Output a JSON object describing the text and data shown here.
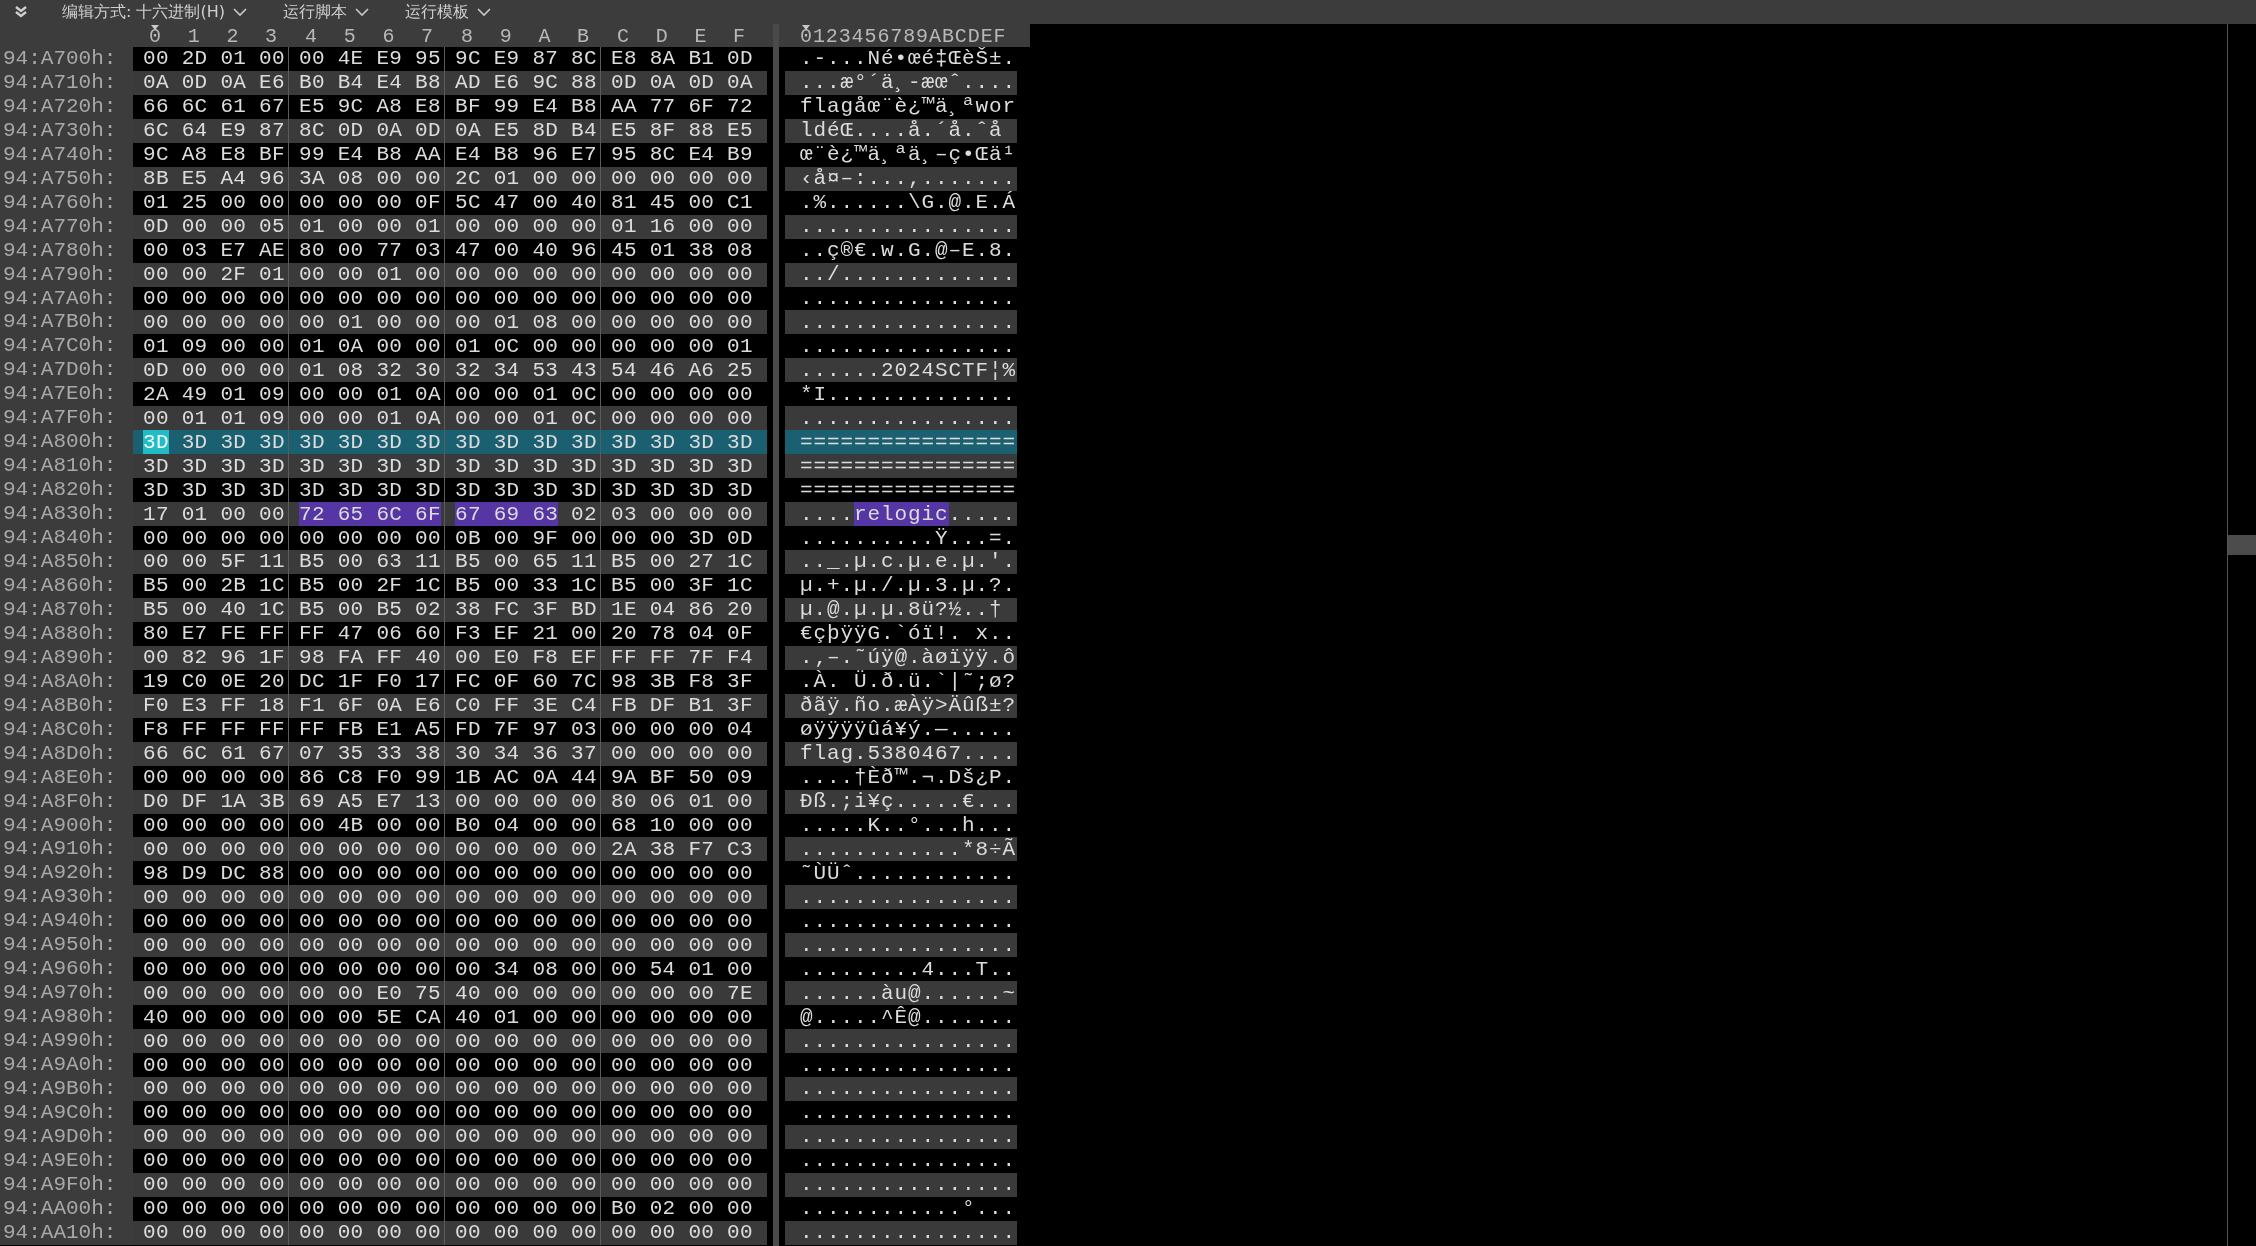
{
  "toolbar": {
    "menus": [
      "编辑方式: 十六进制(H)",
      "运行脚本",
      "运行模板"
    ]
  },
  "header": {
    "hex_columns": [
      {
        "label": "0",
        "cursor": true
      },
      {
        "label": "1",
        "cursor": false
      },
      {
        "label": "2",
        "cursor": false
      },
      {
        "label": "3",
        "cursor": false
      },
      {
        "label": "4",
        "cursor": false
      },
      {
        "label": "5",
        "cursor": false
      },
      {
        "label": "6",
        "cursor": false
      },
      {
        "label": "7",
        "cursor": false
      },
      {
        "label": "8",
        "cursor": false
      },
      {
        "label": "9",
        "cursor": false
      },
      {
        "label": "A",
        "cursor": false
      },
      {
        "label": "B",
        "cursor": false
      },
      {
        "label": "C",
        "cursor": false
      },
      {
        "label": "D",
        "cursor": false
      },
      {
        "label": "E",
        "cursor": false
      },
      {
        "label": "F",
        "cursor": false
      }
    ],
    "ascii": [
      {
        "text": "0",
        "cursor": true
      },
      {
        "text": "123456789ABCDEF",
        "cursor": false
      }
    ]
  },
  "rows": [
    {
      "offset": "94:A700h:",
      "selected": false,
      "hex": [
        [
          {
            "kind": "plain",
            "text": "00 2D 01 00"
          }
        ],
        [
          {
            "kind": "plain",
            "text": "00 4E E9 95"
          }
        ],
        [
          {
            "kind": "plain",
            "text": "9C E9 87 8C"
          }
        ],
        [
          {
            "kind": "plain",
            "text": "E8 8A B1 0D"
          }
        ]
      ],
      "ascii": [
        {
          "kind": "plain",
          "text": ".-...Né•œé‡ŒèŠ±."
        }
      ]
    },
    {
      "offset": "94:A710h:",
      "selected": false,
      "hex": [
        [
          {
            "kind": "plain",
            "text": "0A 0D 0A E6"
          }
        ],
        [
          {
            "kind": "plain",
            "text": "B0 B4 E4 B8"
          }
        ],
        [
          {
            "kind": "plain",
            "text": "AD E6 9C 88"
          }
        ],
        [
          {
            "kind": "plain",
            "text": "0D 0A 0D 0A"
          }
        ]
      ],
      "ascii": [
        {
          "kind": "plain",
          "text": "...æ°´ä¸-æœˆ...."
        }
      ]
    },
    {
      "offset": "94:A720h:",
      "selected": false,
      "hex": [
        [
          {
            "kind": "plain",
            "text": "66 6C 61 67"
          }
        ],
        [
          {
            "kind": "plain",
            "text": "E5 9C A8 E8"
          }
        ],
        [
          {
            "kind": "plain",
            "text": "BF 99 E4 B8"
          }
        ],
        [
          {
            "kind": "plain",
            "text": "AA 77 6F 72"
          }
        ]
      ],
      "ascii": [
        {
          "kind": "plain",
          "text": "flagåœ¨è¿™ä¸ªwor"
        }
      ]
    },
    {
      "offset": "94:A730h:",
      "selected": false,
      "hex": [
        [
          {
            "kind": "plain",
            "text": "6C 64 E9 87"
          }
        ],
        [
          {
            "kind": "plain",
            "text": "8C 0D 0A 0D"
          }
        ],
        [
          {
            "kind": "plain",
            "text": "0A E5 8D B4"
          }
        ],
        [
          {
            "kind": "plain",
            "text": "E5 8F 88 E5"
          }
        ]
      ],
      "ascii": [
        {
          "kind": "plain",
          "text": "ldéŒ....å.´å.ˆå"
        }
      ]
    },
    {
      "offset": "94:A740h:",
      "selected": false,
      "hex": [
        [
          {
            "kind": "plain",
            "text": "9C A8 E8 BF"
          }
        ],
        [
          {
            "kind": "plain",
            "text": "99 E4 B8 AA"
          }
        ],
        [
          {
            "kind": "plain",
            "text": "E4 B8 96 E7"
          }
        ],
        [
          {
            "kind": "plain",
            "text": "95 8C E4 B9"
          }
        ]
      ],
      "ascii": [
        {
          "kind": "plain",
          "text": "œ¨è¿™ä¸ªä¸–ç•Œä¹"
        }
      ]
    },
    {
      "offset": "94:A750h:",
      "selected": false,
      "hex": [
        [
          {
            "kind": "plain",
            "text": "8B E5 A4 96"
          }
        ],
        [
          {
            "kind": "plain",
            "text": "3A 08 00 00"
          }
        ],
        [
          {
            "kind": "plain",
            "text": "2C 01 00 00"
          }
        ],
        [
          {
            "kind": "plain",
            "text": "00 00 00 00"
          }
        ]
      ],
      "ascii": [
        {
          "kind": "plain",
          "text": "‹å¤–:...,......."
        }
      ]
    },
    {
      "offset": "94:A760h:",
      "selected": false,
      "hex": [
        [
          {
            "kind": "plain",
            "text": "01 25 00 00"
          }
        ],
        [
          {
            "kind": "plain",
            "text": "00 00 00 0F"
          }
        ],
        [
          {
            "kind": "plain",
            "text": "5C 47 00 40"
          }
        ],
        [
          {
            "kind": "plain",
            "text": "81 45 00 C1"
          }
        ]
      ],
      "ascii": [
        {
          "kind": "plain",
          "text": ".%......\\G.@.E.Á"
        }
      ]
    },
    {
      "offset": "94:A770h:",
      "selected": false,
      "hex": [
        [
          {
            "kind": "plain",
            "text": "0D 00 00 05"
          }
        ],
        [
          {
            "kind": "plain",
            "text": "01 00 00 01"
          }
        ],
        [
          {
            "kind": "plain",
            "text": "00 00 00 00"
          }
        ],
        [
          {
            "kind": "plain",
            "text": "01 16 00 00"
          }
        ]
      ],
      "ascii": [
        {
          "kind": "plain",
          "text": "................"
        }
      ]
    },
    {
      "offset": "94:A780h:",
      "selected": false,
      "hex": [
        [
          {
            "kind": "plain",
            "text": "00 03 E7 AE"
          }
        ],
        [
          {
            "kind": "plain",
            "text": "80 00 77 03"
          }
        ],
        [
          {
            "kind": "plain",
            "text": "47 00 40 96"
          }
        ],
        [
          {
            "kind": "plain",
            "text": "45 01 38 08"
          }
        ]
      ],
      "ascii": [
        {
          "kind": "plain",
          "text": "..ç®€.w.G.@–E.8."
        }
      ]
    },
    {
      "offset": "94:A790h:",
      "selected": false,
      "hex": [
        [
          {
            "kind": "plain",
            "text": "00 00 2F 01"
          }
        ],
        [
          {
            "kind": "plain",
            "text": "00 00 01 00"
          }
        ],
        [
          {
            "kind": "plain",
            "text": "00 00 00 00"
          }
        ],
        [
          {
            "kind": "plain",
            "text": "00 00 00 00"
          }
        ]
      ],
      "ascii": [
        {
          "kind": "plain",
          "text": "../............."
        }
      ]
    },
    {
      "offset": "94:A7A0h:",
      "selected": false,
      "hex": [
        [
          {
            "kind": "plain",
            "text": "00 00 00 00"
          }
        ],
        [
          {
            "kind": "plain",
            "text": "00 00 00 00"
          }
        ],
        [
          {
            "kind": "plain",
            "text": "00 00 00 00"
          }
        ],
        [
          {
            "kind": "plain",
            "text": "00 00 00 00"
          }
        ]
      ],
      "ascii": [
        {
          "kind": "plain",
          "text": "................"
        }
      ]
    },
    {
      "offset": "94:A7B0h:",
      "selected": false,
      "hex": [
        [
          {
            "kind": "plain",
            "text": "00 00 00 00"
          }
        ],
        [
          {
            "kind": "plain",
            "text": "00 01 00 00"
          }
        ],
        [
          {
            "kind": "plain",
            "text": "00 01 08 00"
          }
        ],
        [
          {
            "kind": "plain",
            "text": "00 00 00 00"
          }
        ]
      ],
      "ascii": [
        {
          "kind": "plain",
          "text": "................"
        }
      ]
    },
    {
      "offset": "94:A7C0h:",
      "selected": false,
      "hex": [
        [
          {
            "kind": "plain",
            "text": "01 09 00 00"
          }
        ],
        [
          {
            "kind": "plain",
            "text": "01 0A 00 00"
          }
        ],
        [
          {
            "kind": "plain",
            "text": "01 0C 00 00"
          }
        ],
        [
          {
            "kind": "plain",
            "text": "00 00 00 01"
          }
        ]
      ],
      "ascii": [
        {
          "kind": "plain",
          "text": "................"
        }
      ]
    },
    {
      "offset": "94:A7D0h:",
      "selected": false,
      "hex": [
        [
          {
            "kind": "plain",
            "text": "0D 00 00 00"
          }
        ],
        [
          {
            "kind": "plain",
            "text": "01 08 32 30"
          }
        ],
        [
          {
            "kind": "plain",
            "text": "32 34 53 43"
          }
        ],
        [
          {
            "kind": "plain",
            "text": "54 46 A6 25"
          }
        ]
      ],
      "ascii": [
        {
          "kind": "plain",
          "text": "......2024SCTF¦%"
        }
      ]
    },
    {
      "offset": "94:A7E0h:",
      "selected": false,
      "hex": [
        [
          {
            "kind": "plain",
            "text": "2A 49 01 09"
          }
        ],
        [
          {
            "kind": "plain",
            "text": "00 00 01 0A"
          }
        ],
        [
          {
            "kind": "plain",
            "text": "00 00 01 0C"
          }
        ],
        [
          {
            "kind": "plain",
            "text": "00 00 00 00"
          }
        ]
      ],
      "ascii": [
        {
          "kind": "plain",
          "text": "*I.............."
        }
      ]
    },
    {
      "offset": "94:A7F0h:",
      "selected": false,
      "hex": [
        [
          {
            "kind": "plain",
            "text": "00 01 01 09"
          }
        ],
        [
          {
            "kind": "plain",
            "text": "00 00 01 0A"
          }
        ],
        [
          {
            "kind": "plain",
            "text": "00 00 01 0C"
          }
        ],
        [
          {
            "kind": "plain",
            "text": "00 00 00 00"
          }
        ]
      ],
      "ascii": [
        {
          "kind": "plain",
          "text": "................"
        }
      ]
    },
    {
      "offset": "94:A800h:",
      "selected": true,
      "hex": [
        [
          {
            "kind": "cursor",
            "text": "3D"
          },
          {
            "kind": "plain",
            "text": "3D 3D 3D"
          }
        ],
        [
          {
            "kind": "plain",
            "text": "3D 3D 3D 3D"
          }
        ],
        [
          {
            "kind": "plain",
            "text": "3D 3D 3D 3D"
          }
        ],
        [
          {
            "kind": "plain",
            "text": "3D 3D 3D 3D"
          }
        ]
      ],
      "ascii": [
        {
          "kind": "plain",
          "text": "================"
        }
      ]
    },
    {
      "offset": "94:A810h:",
      "selected": false,
      "hex": [
        [
          {
            "kind": "plain",
            "text": "3D 3D 3D 3D"
          }
        ],
        [
          {
            "kind": "plain",
            "text": "3D 3D 3D 3D"
          }
        ],
        [
          {
            "kind": "plain",
            "text": "3D 3D 3D 3D"
          }
        ],
        [
          {
            "kind": "plain",
            "text": "3D 3D 3D 3D"
          }
        ]
      ],
      "ascii": [
        {
          "kind": "plain",
          "text": "================"
        }
      ]
    },
    {
      "offset": "94:A820h:",
      "selected": false,
      "hex": [
        [
          {
            "kind": "plain",
            "text": "3D 3D 3D 3D"
          }
        ],
        [
          {
            "kind": "plain",
            "text": "3D 3D 3D 3D"
          }
        ],
        [
          {
            "kind": "plain",
            "text": "3D 3D 3D 3D"
          }
        ],
        [
          {
            "kind": "plain",
            "text": "3D 3D 3D 3D"
          }
        ]
      ],
      "ascii": [
        {
          "kind": "plain",
          "text": "================"
        }
      ]
    },
    {
      "offset": "94:A830h:",
      "selected": false,
      "hex": [
        [
          {
            "kind": "plain",
            "text": "17 01 00 00"
          }
        ],
        [
          {
            "kind": "match",
            "text": "72 65 6C 6F"
          }
        ],
        [
          {
            "kind": "match",
            "text": "67 69 63"
          },
          {
            "kind": "plain",
            "text": "02"
          }
        ],
        [
          {
            "kind": "plain",
            "text": "03 00 00 00"
          }
        ]
      ],
      "ascii": [
        {
          "kind": "plain",
          "text": "...."
        },
        {
          "kind": "match",
          "text": "relogic"
        },
        {
          "kind": "plain",
          "text": "....."
        }
      ]
    },
    {
      "offset": "94:A840h:",
      "selected": false,
      "hex": [
        [
          {
            "kind": "plain",
            "text": "00 00 00 00"
          }
        ],
        [
          {
            "kind": "plain",
            "text": "00 00 00 00"
          }
        ],
        [
          {
            "kind": "plain",
            "text": "0B 00 9F 00"
          }
        ],
        [
          {
            "kind": "plain",
            "text": "00 00 3D 0D"
          }
        ]
      ],
      "ascii": [
        {
          "kind": "plain",
          "text": "..........Ÿ...=."
        }
      ]
    },
    {
      "offset": "94:A850h:",
      "selected": false,
      "hex": [
        [
          {
            "kind": "plain",
            "text": "00 00 5F 11"
          }
        ],
        [
          {
            "kind": "plain",
            "text": "B5 00 63 11"
          }
        ],
        [
          {
            "kind": "plain",
            "text": "B5 00 65 11"
          }
        ],
        [
          {
            "kind": "plain",
            "text": "B5 00 27 1C"
          }
        ]
      ],
      "ascii": [
        {
          "kind": "plain",
          "text": ".._.µ.c.µ.e.µ.'."
        }
      ]
    },
    {
      "offset": "94:A860h:",
      "selected": false,
      "hex": [
        [
          {
            "kind": "plain",
            "text": "B5 00 2B 1C"
          }
        ],
        [
          {
            "kind": "plain",
            "text": "B5 00 2F 1C"
          }
        ],
        [
          {
            "kind": "plain",
            "text": "B5 00 33 1C"
          }
        ],
        [
          {
            "kind": "plain",
            "text": "B5 00 3F 1C"
          }
        ]
      ],
      "ascii": [
        {
          "kind": "plain",
          "text": "µ.+.µ./.µ.3.µ.?."
        }
      ]
    },
    {
      "offset": "94:A870h:",
      "selected": false,
      "hex": [
        [
          {
            "kind": "plain",
            "text": "B5 00 40 1C"
          }
        ],
        [
          {
            "kind": "plain",
            "text": "B5 00 B5 02"
          }
        ],
        [
          {
            "kind": "plain",
            "text": "38 FC 3F BD"
          }
        ],
        [
          {
            "kind": "plain",
            "text": "1E 04 86 20"
          }
        ]
      ],
      "ascii": [
        {
          "kind": "plain",
          "text": "µ.@.µ.µ.8ü?½..†"
        }
      ]
    },
    {
      "offset": "94:A880h:",
      "selected": false,
      "hex": [
        [
          {
            "kind": "plain",
            "text": "80 E7 FE FF"
          }
        ],
        [
          {
            "kind": "plain",
            "text": "FF 47 06 60"
          }
        ],
        [
          {
            "kind": "plain",
            "text": "F3 EF 21 00"
          }
        ],
        [
          {
            "kind": "plain",
            "text": "20 78 04 0F"
          }
        ]
      ],
      "ascii": [
        {
          "kind": "plain",
          "text": "€çþÿÿG.`óï!. x.."
        }
      ]
    },
    {
      "offset": "94:A890h:",
      "selected": false,
      "hex": [
        [
          {
            "kind": "plain",
            "text": "00 82 96 1F"
          }
        ],
        [
          {
            "kind": "plain",
            "text": "98 FA FF 40"
          }
        ],
        [
          {
            "kind": "plain",
            "text": "00 E0 F8 EF"
          }
        ],
        [
          {
            "kind": "plain",
            "text": "FF FF 7F F4"
          }
        ]
      ],
      "ascii": [
        {
          "kind": "plain",
          "text": ".‚–.˜úÿ@.àøïÿÿ.ô"
        }
      ]
    },
    {
      "offset": "94:A8A0h:",
      "selected": false,
      "hex": [
        [
          {
            "kind": "plain",
            "text": "19 C0 0E 20"
          }
        ],
        [
          {
            "kind": "plain",
            "text": "DC 1F F0 17"
          }
        ],
        [
          {
            "kind": "plain",
            "text": "FC 0F 60 7C"
          }
        ],
        [
          {
            "kind": "plain",
            "text": "98 3B F8 3F"
          }
        ]
      ],
      "ascii": [
        {
          "kind": "plain",
          "text": ".À. Ü.ð.ü.`|˜;ø?"
        }
      ]
    },
    {
      "offset": "94:A8B0h:",
      "selected": false,
      "hex": [
        [
          {
            "kind": "plain",
            "text": "F0 E3 FF 18"
          }
        ],
        [
          {
            "kind": "plain",
            "text": "F1 6F 0A E6"
          }
        ],
        [
          {
            "kind": "plain",
            "text": "C0 FF 3E C4"
          }
        ],
        [
          {
            "kind": "plain",
            "text": "FB DF B1 3F"
          }
        ]
      ],
      "ascii": [
        {
          "kind": "plain",
          "text": "ðãÿ.ño.æÀÿ>Äûß±?"
        }
      ]
    },
    {
      "offset": "94:A8C0h:",
      "selected": false,
      "hex": [
        [
          {
            "kind": "plain",
            "text": "F8 FF FF FF"
          }
        ],
        [
          {
            "kind": "plain",
            "text": "FF FB E1 A5"
          }
        ],
        [
          {
            "kind": "plain",
            "text": "FD 7F 97 03"
          }
        ],
        [
          {
            "kind": "plain",
            "text": "00 00 00 04"
          }
        ]
      ],
      "ascii": [
        {
          "kind": "plain",
          "text": "øÿÿÿÿûá¥ý.—....."
        }
      ]
    },
    {
      "offset": "94:A8D0h:",
      "selected": false,
      "hex": [
        [
          {
            "kind": "plain",
            "text": "66 6C 61 67"
          }
        ],
        [
          {
            "kind": "plain",
            "text": "07 35 33 38"
          }
        ],
        [
          {
            "kind": "plain",
            "text": "30 34 36 37"
          }
        ],
        [
          {
            "kind": "plain",
            "text": "00 00 00 00"
          }
        ]
      ],
      "ascii": [
        {
          "kind": "plain",
          "text": "flag.5380467...."
        }
      ]
    },
    {
      "offset": "94:A8E0h:",
      "selected": false,
      "hex": [
        [
          {
            "kind": "plain",
            "text": "00 00 00 00"
          }
        ],
        [
          {
            "kind": "plain",
            "text": "86 C8 F0 99"
          }
        ],
        [
          {
            "kind": "plain",
            "text": "1B AC 0A 44"
          }
        ],
        [
          {
            "kind": "plain",
            "text": "9A BF 50 09"
          }
        ]
      ],
      "ascii": [
        {
          "kind": "plain",
          "text": "....†Èð™.¬.Dš¿P."
        }
      ]
    },
    {
      "offset": "94:A8F0h:",
      "selected": false,
      "hex": [
        [
          {
            "kind": "plain",
            "text": "D0 DF 1A 3B"
          }
        ],
        [
          {
            "kind": "plain",
            "text": "69 A5 E7 13"
          }
        ],
        [
          {
            "kind": "plain",
            "text": "00 00 00 00"
          }
        ],
        [
          {
            "kind": "plain",
            "text": "80 06 01 00"
          }
        ]
      ],
      "ascii": [
        {
          "kind": "plain",
          "text": "Ðß.;i¥ç.....€..."
        }
      ]
    },
    {
      "offset": "94:A900h:",
      "selected": false,
      "hex": [
        [
          {
            "kind": "plain",
            "text": "00 00 00 00"
          }
        ],
        [
          {
            "kind": "plain",
            "text": "00 4B 00 00"
          }
        ],
        [
          {
            "kind": "plain",
            "text": "B0 04 00 00"
          }
        ],
        [
          {
            "kind": "plain",
            "text": "68 10 00 00"
          }
        ]
      ],
      "ascii": [
        {
          "kind": "plain",
          "text": ".....K..°...h..."
        }
      ]
    },
    {
      "offset": "94:A910h:",
      "selected": false,
      "hex": [
        [
          {
            "kind": "plain",
            "text": "00 00 00 00"
          }
        ],
        [
          {
            "kind": "plain",
            "text": "00 00 00 00"
          }
        ],
        [
          {
            "kind": "plain",
            "text": "00 00 00 00"
          }
        ],
        [
          {
            "kind": "plain",
            "text": "2A 38 F7 C3"
          }
        ]
      ],
      "ascii": [
        {
          "kind": "plain",
          "text": "............*8÷Ã"
        }
      ]
    },
    {
      "offset": "94:A920h:",
      "selected": false,
      "hex": [
        [
          {
            "kind": "plain",
            "text": "98 D9 DC 88"
          }
        ],
        [
          {
            "kind": "plain",
            "text": "00 00 00 00"
          }
        ],
        [
          {
            "kind": "plain",
            "text": "00 00 00 00"
          }
        ],
        [
          {
            "kind": "plain",
            "text": "00 00 00 00"
          }
        ]
      ],
      "ascii": [
        {
          "kind": "plain",
          "text": "˜ÙÜˆ............"
        }
      ]
    },
    {
      "offset": "94:A930h:",
      "selected": false,
      "hex": [
        [
          {
            "kind": "plain",
            "text": "00 00 00 00"
          }
        ],
        [
          {
            "kind": "plain",
            "text": "00 00 00 00"
          }
        ],
        [
          {
            "kind": "plain",
            "text": "00 00 00 00"
          }
        ],
        [
          {
            "kind": "plain",
            "text": "00 00 00 00"
          }
        ]
      ],
      "ascii": [
        {
          "kind": "plain",
          "text": "................"
        }
      ]
    },
    {
      "offset": "94:A940h:",
      "selected": false,
      "hex": [
        [
          {
            "kind": "plain",
            "text": "00 00 00 00"
          }
        ],
        [
          {
            "kind": "plain",
            "text": "00 00 00 00"
          }
        ],
        [
          {
            "kind": "plain",
            "text": "00 00 00 00"
          }
        ],
        [
          {
            "kind": "plain",
            "text": "00 00 00 00"
          }
        ]
      ],
      "ascii": [
        {
          "kind": "plain",
          "text": "................"
        }
      ]
    },
    {
      "offset": "94:A950h:",
      "selected": false,
      "hex": [
        [
          {
            "kind": "plain",
            "text": "00 00 00 00"
          }
        ],
        [
          {
            "kind": "plain",
            "text": "00 00 00 00"
          }
        ],
        [
          {
            "kind": "plain",
            "text": "00 00 00 00"
          }
        ],
        [
          {
            "kind": "plain",
            "text": "00 00 00 00"
          }
        ]
      ],
      "ascii": [
        {
          "kind": "plain",
          "text": "................"
        }
      ]
    },
    {
      "offset": "94:A960h:",
      "selected": false,
      "hex": [
        [
          {
            "kind": "plain",
            "text": "00 00 00 00"
          }
        ],
        [
          {
            "kind": "plain",
            "text": "00 00 00 00"
          }
        ],
        [
          {
            "kind": "plain",
            "text": "00 34 08 00"
          }
        ],
        [
          {
            "kind": "plain",
            "text": "00 54 01 00"
          }
        ]
      ],
      "ascii": [
        {
          "kind": "plain",
          "text": ".........4...T.."
        }
      ]
    },
    {
      "offset": "94:A970h:",
      "selected": false,
      "hex": [
        [
          {
            "kind": "plain",
            "text": "00 00 00 00"
          }
        ],
        [
          {
            "kind": "plain",
            "text": "00 00 E0 75"
          }
        ],
        [
          {
            "kind": "plain",
            "text": "40 00 00 00"
          }
        ],
        [
          {
            "kind": "plain",
            "text": "00 00 00 7E"
          }
        ]
      ],
      "ascii": [
        {
          "kind": "plain",
          "text": "......àu@......~"
        }
      ]
    },
    {
      "offset": "94:A980h:",
      "selected": false,
      "hex": [
        [
          {
            "kind": "plain",
            "text": "40 00 00 00"
          }
        ],
        [
          {
            "kind": "plain",
            "text": "00 00 5E CA"
          }
        ],
        [
          {
            "kind": "plain",
            "text": "40 01 00 00"
          }
        ],
        [
          {
            "kind": "plain",
            "text": "00 00 00 00"
          }
        ]
      ],
      "ascii": [
        {
          "kind": "plain",
          "text": "@.....^Ê@......."
        }
      ]
    },
    {
      "offset": "94:A990h:",
      "selected": false,
      "hex": [
        [
          {
            "kind": "plain",
            "text": "00 00 00 00"
          }
        ],
        [
          {
            "kind": "plain",
            "text": "00 00 00 00"
          }
        ],
        [
          {
            "kind": "plain",
            "text": "00 00 00 00"
          }
        ],
        [
          {
            "kind": "plain",
            "text": "00 00 00 00"
          }
        ]
      ],
      "ascii": [
        {
          "kind": "plain",
          "text": "................"
        }
      ]
    },
    {
      "offset": "94:A9A0h:",
      "selected": false,
      "hex": [
        [
          {
            "kind": "plain",
            "text": "00 00 00 00"
          }
        ],
        [
          {
            "kind": "plain",
            "text": "00 00 00 00"
          }
        ],
        [
          {
            "kind": "plain",
            "text": "00 00 00 00"
          }
        ],
        [
          {
            "kind": "plain",
            "text": "00 00 00 00"
          }
        ]
      ],
      "ascii": [
        {
          "kind": "plain",
          "text": "................"
        }
      ]
    },
    {
      "offset": "94:A9B0h:",
      "selected": false,
      "hex": [
        [
          {
            "kind": "plain",
            "text": "00 00 00 00"
          }
        ],
        [
          {
            "kind": "plain",
            "text": "00 00 00 00"
          }
        ],
        [
          {
            "kind": "plain",
            "text": "00 00 00 00"
          }
        ],
        [
          {
            "kind": "plain",
            "text": "00 00 00 00"
          }
        ]
      ],
      "ascii": [
        {
          "kind": "plain",
          "text": "................"
        }
      ]
    },
    {
      "offset": "94:A9C0h:",
      "selected": false,
      "hex": [
        [
          {
            "kind": "plain",
            "text": "00 00 00 00"
          }
        ],
        [
          {
            "kind": "plain",
            "text": "00 00 00 00"
          }
        ],
        [
          {
            "kind": "plain",
            "text": "00 00 00 00"
          }
        ],
        [
          {
            "kind": "plain",
            "text": "00 00 00 00"
          }
        ]
      ],
      "ascii": [
        {
          "kind": "plain",
          "text": "................"
        }
      ]
    },
    {
      "offset": "94:A9D0h:",
      "selected": false,
      "hex": [
        [
          {
            "kind": "plain",
            "text": "00 00 00 00"
          }
        ],
        [
          {
            "kind": "plain",
            "text": "00 00 00 00"
          }
        ],
        [
          {
            "kind": "plain",
            "text": "00 00 00 00"
          }
        ],
        [
          {
            "kind": "plain",
            "text": "00 00 00 00"
          }
        ]
      ],
      "ascii": [
        {
          "kind": "plain",
          "text": "................"
        }
      ]
    },
    {
      "offset": "94:A9E0h:",
      "selected": false,
      "hex": [
        [
          {
            "kind": "plain",
            "text": "00 00 00 00"
          }
        ],
        [
          {
            "kind": "plain",
            "text": "00 00 00 00"
          }
        ],
        [
          {
            "kind": "plain",
            "text": "00 00 00 00"
          }
        ],
        [
          {
            "kind": "plain",
            "text": "00 00 00 00"
          }
        ]
      ],
      "ascii": [
        {
          "kind": "plain",
          "text": "................"
        }
      ]
    },
    {
      "offset": "94:A9F0h:",
      "selected": false,
      "hex": [
        [
          {
            "kind": "plain",
            "text": "00 00 00 00"
          }
        ],
        [
          {
            "kind": "plain",
            "text": "00 00 00 00"
          }
        ],
        [
          {
            "kind": "plain",
            "text": "00 00 00 00"
          }
        ],
        [
          {
            "kind": "plain",
            "text": "00 00 00 00"
          }
        ]
      ],
      "ascii": [
        {
          "kind": "plain",
          "text": "................"
        }
      ]
    },
    {
      "offset": "94:AA00h:",
      "selected": false,
      "hex": [
        [
          {
            "kind": "plain",
            "text": "00 00 00 00"
          }
        ],
        [
          {
            "kind": "plain",
            "text": "00 00 00 00"
          }
        ],
        [
          {
            "kind": "plain",
            "text": "00 00 00 00"
          }
        ],
        [
          {
            "kind": "plain",
            "text": "B0 02 00 00"
          }
        ]
      ],
      "ascii": [
        {
          "kind": "plain",
          "text": "............°..."
        }
      ]
    },
    {
      "offset": "94:AA10h:",
      "selected": false,
      "hex": [
        [
          {
            "kind": "plain",
            "text": "00 00 00 00"
          }
        ],
        [
          {
            "kind": "plain",
            "text": "00 00 00 00"
          }
        ],
        [
          {
            "kind": "plain",
            "text": "00 00 00 00"
          }
        ],
        [
          {
            "kind": "plain",
            "text": "00 00 00 00"
          }
        ]
      ],
      "ascii": [
        {
          "kind": "plain",
          "text": "................"
        }
      ]
    }
  ]
}
